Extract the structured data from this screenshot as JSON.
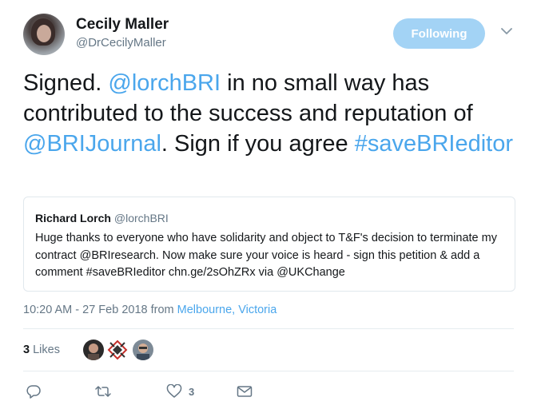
{
  "author": {
    "display_name": "Cecily Maller",
    "handle": "@DrCecilyMaller",
    "follow_label": "Following"
  },
  "tweet": {
    "text_parts": [
      {
        "text": "Signed. ",
        "link": false
      },
      {
        "text": "@lorchBRI",
        "link": true
      },
      {
        "text": " in no small way has contributed to the success and reputation of ",
        "link": false
      },
      {
        "text": "@BRIJournal",
        "link": true
      },
      {
        "text": ". Sign if you agree ",
        "link": false
      },
      {
        "text": "#saveBRIeditor",
        "link": true
      }
    ]
  },
  "quoted_tweet": {
    "name": "Richard Lorch",
    "handle": "@lorchBRI",
    "text": "Huge thanks to everyone who have solidarity and object to T&F's decision to terminate my contract @BRIresearch.  Now make sure your voice is heard - sign this petition & add a comment #saveBRIeditor chn.ge/2sOhZRx via @UKChange"
  },
  "meta": {
    "time_date": "10:20 AM - 27 Feb 2018",
    "from_label": "from",
    "location": "Melbourne, Victoria"
  },
  "likes": {
    "count": "3",
    "label": "Likes"
  },
  "actions": {
    "reply_icon": "reply-icon",
    "retweet_icon": "retweet-icon",
    "like_icon": "heart-icon",
    "like_count": "3",
    "dm_icon": "envelope-icon"
  },
  "colors": {
    "link": "#4aa6ec",
    "follow_button": "#a3d3f5",
    "secondary_text": "#657786"
  }
}
